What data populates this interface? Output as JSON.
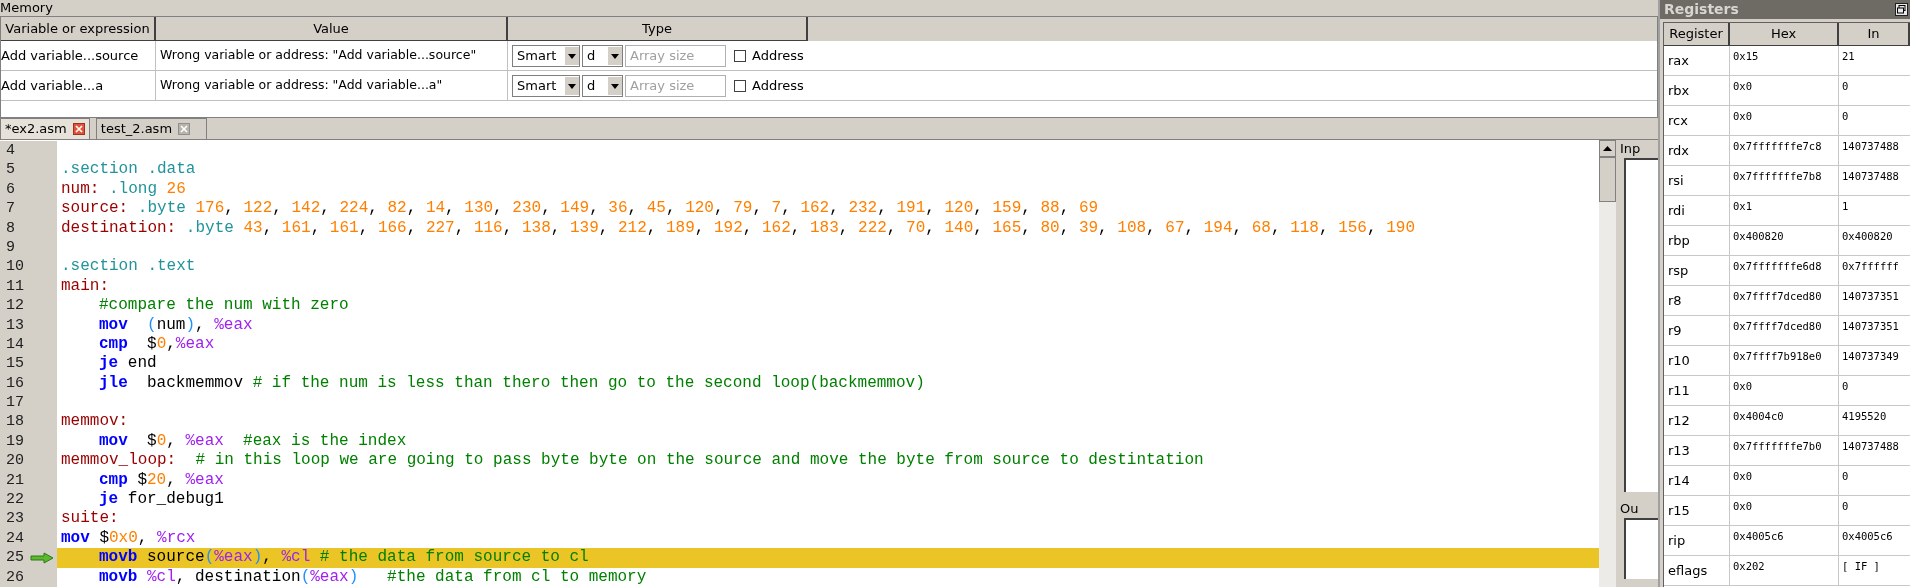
{
  "memory": {
    "title": "Memory",
    "columns": [
      "Variable or expression",
      "Value",
      "Type"
    ],
    "rows": [
      {
        "variable": "Add variable...source",
        "value": "Wrong variable or address: \"Add variable...source\"",
        "mode": "Smart",
        "format": "d",
        "array_size": {
          "placeholder": "Array size"
        },
        "address": {
          "label": "Address",
          "checked": false
        }
      },
      {
        "variable": "Add variable...a",
        "value": "Wrong variable or address: \"Add variable...a\"",
        "mode": "Smart",
        "format": "d",
        "array_size": {
          "placeholder": "Array size"
        },
        "address": {
          "label": "Address",
          "checked": false
        }
      }
    ]
  },
  "tabs": [
    {
      "label": "*ex2.asm",
      "selected": true
    },
    {
      "label": "test_2.asm",
      "selected": false
    }
  ],
  "editor": {
    "lines": [
      {
        "number": "4"
      },
      {
        "number": "5",
        "indented": false,
        "current": false,
        "tokens": [
          {
            "kind": "dir",
            "text": ".section .data"
          }
        ]
      },
      {
        "number": "6",
        "indented": false,
        "current": false,
        "tokens": [
          {
            "kind": "label",
            "text": "num:"
          },
          {
            "kind": "dir",
            "text": " .long"
          },
          {
            "kind": "num",
            "text": " 26"
          }
        ]
      },
      {
        "number": "7",
        "indented": false,
        "current": false,
        "tokens": [
          {
            "kind": "label",
            "text": "source:"
          },
          {
            "kind": "dir",
            "text": " .byte"
          },
          {
            "kind": "num",
            "text": " 176"
          },
          {
            "kind": "plain",
            "text": ", "
          },
          {
            "kind": "num",
            "text": "122"
          },
          {
            "kind": "plain",
            "text": ", "
          },
          {
            "kind": "num",
            "text": "142"
          },
          {
            "kind": "plain",
            "text": ", "
          },
          {
            "kind": "num",
            "text": "224"
          },
          {
            "kind": "plain",
            "text": ", "
          },
          {
            "kind": "num",
            "text": "82"
          },
          {
            "kind": "plain",
            "text": ", "
          },
          {
            "kind": "num",
            "text": "14"
          },
          {
            "kind": "plain",
            "text": ", "
          },
          {
            "kind": "num",
            "text": "130"
          },
          {
            "kind": "plain",
            "text": ", "
          },
          {
            "kind": "num",
            "text": "230"
          },
          {
            "kind": "plain",
            "text": ", "
          },
          {
            "kind": "num",
            "text": "149"
          },
          {
            "kind": "plain",
            "text": ", "
          },
          {
            "kind": "num",
            "text": "36"
          },
          {
            "kind": "plain",
            "text": ", "
          },
          {
            "kind": "num",
            "text": "45"
          },
          {
            "kind": "plain",
            "text": ", "
          },
          {
            "kind": "num",
            "text": "120"
          },
          {
            "kind": "plain",
            "text": ", "
          },
          {
            "kind": "num",
            "text": "79"
          },
          {
            "kind": "plain",
            "text": ", "
          },
          {
            "kind": "num",
            "text": "7"
          },
          {
            "kind": "plain",
            "text": ", "
          },
          {
            "kind": "num",
            "text": "162"
          },
          {
            "kind": "plain",
            "text": ", "
          },
          {
            "kind": "num",
            "text": "232"
          },
          {
            "kind": "plain",
            "text": ", "
          },
          {
            "kind": "num",
            "text": "191"
          },
          {
            "kind": "plain",
            "text": ", "
          },
          {
            "kind": "num",
            "text": "120"
          },
          {
            "kind": "plain",
            "text": ", "
          },
          {
            "kind": "num",
            "text": "159"
          },
          {
            "kind": "plain",
            "text": ", "
          },
          {
            "kind": "num",
            "text": "88"
          },
          {
            "kind": "plain",
            "text": ", "
          },
          {
            "kind": "num",
            "text": "69"
          }
        ]
      },
      {
        "number": "8",
        "indented": false,
        "current": false,
        "tokens": [
          {
            "kind": "label",
            "text": "destination:"
          },
          {
            "kind": "dir",
            "text": " .byte"
          },
          {
            "kind": "num",
            "text": " 43"
          },
          {
            "kind": "plain",
            "text": ", "
          },
          {
            "kind": "num",
            "text": "161"
          },
          {
            "kind": "plain",
            "text": ", "
          },
          {
            "kind": "num",
            "text": "161"
          },
          {
            "kind": "plain",
            "text": ", "
          },
          {
            "kind": "num",
            "text": "166"
          },
          {
            "kind": "plain",
            "text": ", "
          },
          {
            "kind": "num",
            "text": "227"
          },
          {
            "kind": "plain",
            "text": ", "
          },
          {
            "kind": "num",
            "text": "116"
          },
          {
            "kind": "plain",
            "text": ", "
          },
          {
            "kind": "num",
            "text": "138"
          },
          {
            "kind": "plain",
            "text": ", "
          },
          {
            "kind": "num",
            "text": "139"
          },
          {
            "kind": "plain",
            "text": ", "
          },
          {
            "kind": "num",
            "text": "212"
          },
          {
            "kind": "plain",
            "text": ", "
          },
          {
            "kind": "num",
            "text": "189"
          },
          {
            "kind": "plain",
            "text": ", "
          },
          {
            "kind": "num",
            "text": "192"
          },
          {
            "kind": "plain",
            "text": ", "
          },
          {
            "kind": "num",
            "text": "162"
          },
          {
            "kind": "plain",
            "text": ", "
          },
          {
            "kind": "num",
            "text": "183"
          },
          {
            "kind": "plain",
            "text": ", "
          },
          {
            "kind": "num",
            "text": "222"
          },
          {
            "kind": "plain",
            "text": ", "
          },
          {
            "kind": "num",
            "text": "70"
          },
          {
            "kind": "plain",
            "text": ", "
          },
          {
            "kind": "num",
            "text": "140"
          },
          {
            "kind": "plain",
            "text": ", "
          },
          {
            "kind": "num",
            "text": "165"
          },
          {
            "kind": "plain",
            "text": ", "
          },
          {
            "kind": "num",
            "text": "80"
          },
          {
            "kind": "plain",
            "text": ", "
          },
          {
            "kind": "num",
            "text": "39"
          },
          {
            "kind": "plain",
            "text": ", "
          },
          {
            "kind": "num",
            "text": "108"
          },
          {
            "kind": "plain",
            "text": ", "
          },
          {
            "kind": "num",
            "text": "67"
          },
          {
            "kind": "plain",
            "text": ", "
          },
          {
            "kind": "num",
            "text": "194"
          },
          {
            "kind": "plain",
            "text": ", "
          },
          {
            "kind": "num",
            "text": "68"
          },
          {
            "kind": "plain",
            "text": ", "
          },
          {
            "kind": "num",
            "text": "118"
          },
          {
            "kind": "plain",
            "text": ", "
          },
          {
            "kind": "num",
            "text": "156"
          },
          {
            "kind": "plain",
            "text": ", "
          },
          {
            "kind": "num",
            "text": "190"
          }
        ]
      },
      {
        "number": "9"
      },
      {
        "number": "10",
        "indented": false,
        "current": false,
        "tokens": [
          {
            "kind": "dir",
            "text": ".section .text"
          }
        ]
      },
      {
        "number": "11",
        "indented": false,
        "current": false,
        "tokens": [
          {
            "kind": "label",
            "text": "main:"
          }
        ]
      },
      {
        "number": "12",
        "indented": true,
        "current": false,
        "tokens": [
          {
            "kind": "comment",
            "text": "#compare the num with zero"
          }
        ]
      },
      {
        "number": "13",
        "indented": true,
        "current": false,
        "tokens": [
          {
            "kind": "kw",
            "text": "mov"
          },
          {
            "kind": "paren",
            "text": "  ("
          },
          {
            "kind": "plain",
            "text": "num"
          },
          {
            "kind": "paren",
            "text": ")"
          },
          {
            "kind": "plain",
            "text": ", "
          },
          {
            "kind": "reg",
            "text": "%eax"
          }
        ]
      },
      {
        "number": "14",
        "indented": true,
        "current": false,
        "tokens": [
          {
            "kind": "kw",
            "text": "cmp"
          },
          {
            "kind": "plain",
            "text": "  $"
          },
          {
            "kind": "num",
            "text": "0"
          },
          {
            "kind": "plain",
            "text": ","
          },
          {
            "kind": "reg",
            "text": "%eax"
          }
        ]
      },
      {
        "number": "15",
        "indented": true,
        "current": false,
        "tokens": [
          {
            "kind": "kw",
            "text": "je"
          },
          {
            "kind": "plain",
            "text": " end"
          }
        ]
      },
      {
        "number": "16",
        "indented": true,
        "current": false,
        "tokens": [
          {
            "kind": "kw",
            "text": "jle"
          },
          {
            "kind": "plain",
            "text": "  backmemmov "
          },
          {
            "kind": "comment",
            "text": "# if the num is less than thero then go to the second loop(backmemmov)"
          }
        ]
      },
      {
        "number": "17"
      },
      {
        "number": "18",
        "indented": false,
        "current": false,
        "tokens": [
          {
            "kind": "label",
            "text": "memmov:"
          }
        ]
      },
      {
        "number": "19",
        "indented": true,
        "current": false,
        "tokens": [
          {
            "kind": "kw",
            "text": "mov"
          },
          {
            "kind": "plain",
            "text": "  $"
          },
          {
            "kind": "num",
            "text": "0"
          },
          {
            "kind": "plain",
            "text": ", "
          },
          {
            "kind": "reg",
            "text": "%eax"
          },
          {
            "kind": "comment",
            "text": "  #eax is the index"
          }
        ]
      },
      {
        "number": "20",
        "indented": false,
        "current": false,
        "tokens": [
          {
            "kind": "label",
            "text": "memmov_loop:"
          },
          {
            "kind": "comment",
            "text": "  # in this loop we are going to pass byte byte on the source and move the byte from source to destintation"
          }
        ]
      },
      {
        "number": "21",
        "indented": true,
        "current": false,
        "tokens": [
          {
            "kind": "kw",
            "text": "cmp"
          },
          {
            "kind": "plain",
            "text": " $"
          },
          {
            "kind": "num",
            "text": "20"
          },
          {
            "kind": "plain",
            "text": ", "
          },
          {
            "kind": "reg",
            "text": "%eax"
          }
        ]
      },
      {
        "number": "22",
        "indented": true,
        "current": false,
        "tokens": [
          {
            "kind": "kw",
            "text": "je"
          },
          {
            "kind": "plain",
            "text": " for_debug1"
          }
        ]
      },
      {
        "number": "23",
        "indented": false,
        "current": false,
        "tokens": [
          {
            "kind": "label",
            "text": "suite:"
          }
        ]
      },
      {
        "number": "24",
        "indented": false,
        "current": false,
        "tokens": [
          {
            "kind": "kw",
            "text": "mov"
          },
          {
            "kind": "plain",
            "text": " $"
          },
          {
            "kind": "num",
            "text": "0x0"
          },
          {
            "kind": "plain",
            "text": ", "
          },
          {
            "kind": "reg",
            "text": "%rcx"
          }
        ]
      },
      {
        "number": "25",
        "indented": true,
        "current": true,
        "tokens": [
          {
            "kind": "kw",
            "text": "movb"
          },
          {
            "kind": "plain",
            "text": " source"
          },
          {
            "kind": "paren",
            "text": "("
          },
          {
            "kind": "reg",
            "text": "%eax"
          },
          {
            "kind": "paren",
            "text": ")"
          },
          {
            "kind": "plain",
            "text": ", "
          },
          {
            "kind": "reg",
            "text": "%cl"
          },
          {
            "kind": "comment",
            "text": " # the data from source to cl"
          }
        ]
      },
      {
        "number": "26",
        "indented": true,
        "current": false,
        "tokens": [
          {
            "kind": "kw",
            "text": "movb"
          },
          {
            "kind": "reg",
            "text": " %cl"
          },
          {
            "kind": "plain",
            "text": ", destination"
          },
          {
            "kind": "paren",
            "text": "("
          },
          {
            "kind": "reg",
            "text": "%eax"
          },
          {
            "kind": "paren",
            "text": ")"
          },
          {
            "kind": "comment",
            "text": "   #the data from cl to memory"
          }
        ]
      }
    ]
  },
  "io_panels": [
    "Inp",
    "Ou"
  ],
  "registers": {
    "title": "Registers",
    "columns": [
      "Register",
      "Hex",
      "In"
    ],
    "rows": [
      {
        "name": "rax",
        "hex": "0x15",
        "int": "21"
      },
      {
        "name": "rbx",
        "hex": "0x0",
        "int": "0"
      },
      {
        "name": "rcx",
        "hex": "0x0",
        "int": "0"
      },
      {
        "name": "rdx",
        "hex": "0x7fffffffe7c8",
        "int": "140737488"
      },
      {
        "name": "rsi",
        "hex": "0x7fffffffe7b8",
        "int": "140737488"
      },
      {
        "name": "rdi",
        "hex": "0x1",
        "int": "1"
      },
      {
        "name": "rbp",
        "hex": "0x400820",
        "int": "0x400820"
      },
      {
        "name": "rsp",
        "hex": "0x7fffffffe6d8",
        "int": "0x7ffffff"
      },
      {
        "name": "r8",
        "hex": "0x7ffff7dced80",
        "int": "140737351"
      },
      {
        "name": "r9",
        "hex": "0x7ffff7dced80",
        "int": "140737351"
      },
      {
        "name": "r10",
        "hex": "0x7ffff7b918e0",
        "int": "140737349"
      },
      {
        "name": "r11",
        "hex": "0x0",
        "int": "0"
      },
      {
        "name": "r12",
        "hex": "0x4004c0",
        "int": "4195520"
      },
      {
        "name": "r13",
        "hex": "0x7fffffffe7b0",
        "int": "140737488"
      },
      {
        "name": "r14",
        "hex": "0x0",
        "int": "0"
      },
      {
        "name": "r15",
        "hex": "0x0",
        "int": "0"
      },
      {
        "name": "rip",
        "hex": "0x4005c6",
        "int": "0x4005c6"
      },
      {
        "name": "eflags",
        "hex": "0x202",
        "int": "[ IF ]"
      }
    ]
  }
}
